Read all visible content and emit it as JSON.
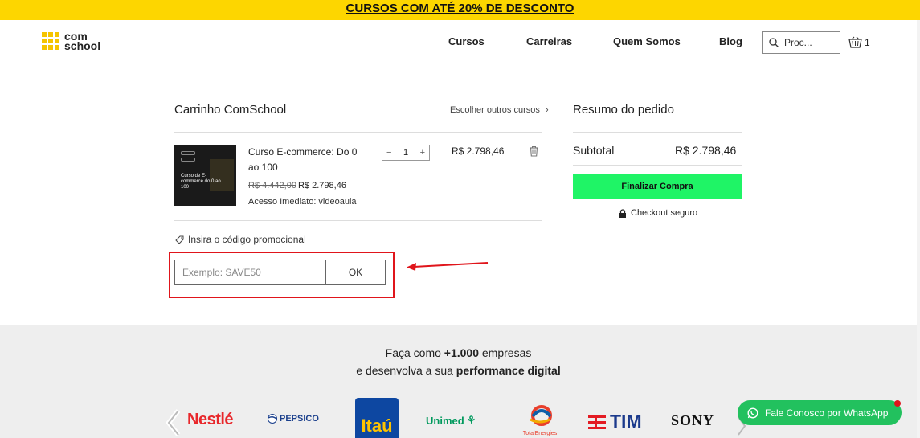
{
  "promo_banner": {
    "text": "CURSOS COM ATÉ 20% DE DESCONTO"
  },
  "header": {
    "logo_line1": "com",
    "logo_line2": "school",
    "nav": [
      "Cursos",
      "Carreiras",
      "Quem Somos",
      "Blog"
    ],
    "search_placeholder": "Proc...",
    "cart_count": "1"
  },
  "cart": {
    "title": "Carrinho ComSchool",
    "other_courses": "Escolher outros cursos",
    "item": {
      "thumb_text": "Curso de E-commerce do 0 ao 100",
      "name": "Curso E-commerce: Do 0 ao 100",
      "old_price": "R$ 4.442,00",
      "new_price": "R$ 2.798,46",
      "access": "Acesso Imediato: videoaula",
      "quantity": "1",
      "line_total": "R$ 2.798,46"
    },
    "promo_label": "Insira o código promocional",
    "promo_placeholder": "Exemplo: SAVE50",
    "ok_label": "OK"
  },
  "summary": {
    "title": "Resumo do pedido",
    "subtotal_label": "Subtotal",
    "subtotal_value": "R$ 2.798,46",
    "checkout_label": "Finalizar Compra",
    "secure_label": "Checkout seguro"
  },
  "partners": {
    "line1_pre": "Faça como ",
    "line1_bold": "+1.000",
    "line1_post": " empresas",
    "line2_pre": "e desenvolva a sua ",
    "line2_bold": "performance digital",
    "logos": [
      "Nestlé",
      "PEPSICO",
      "Itaú",
      "Unimed",
      "TotalEnergies",
      "TIM",
      "SONY"
    ]
  },
  "whatsapp": {
    "label": "Fale Conosco por WhatsApp"
  },
  "colors": {
    "brand_yellow": "#fdd600",
    "checkout_green": "#1ff466",
    "highlight_red": "#e0151b",
    "whatsapp_green": "#22c15e"
  }
}
